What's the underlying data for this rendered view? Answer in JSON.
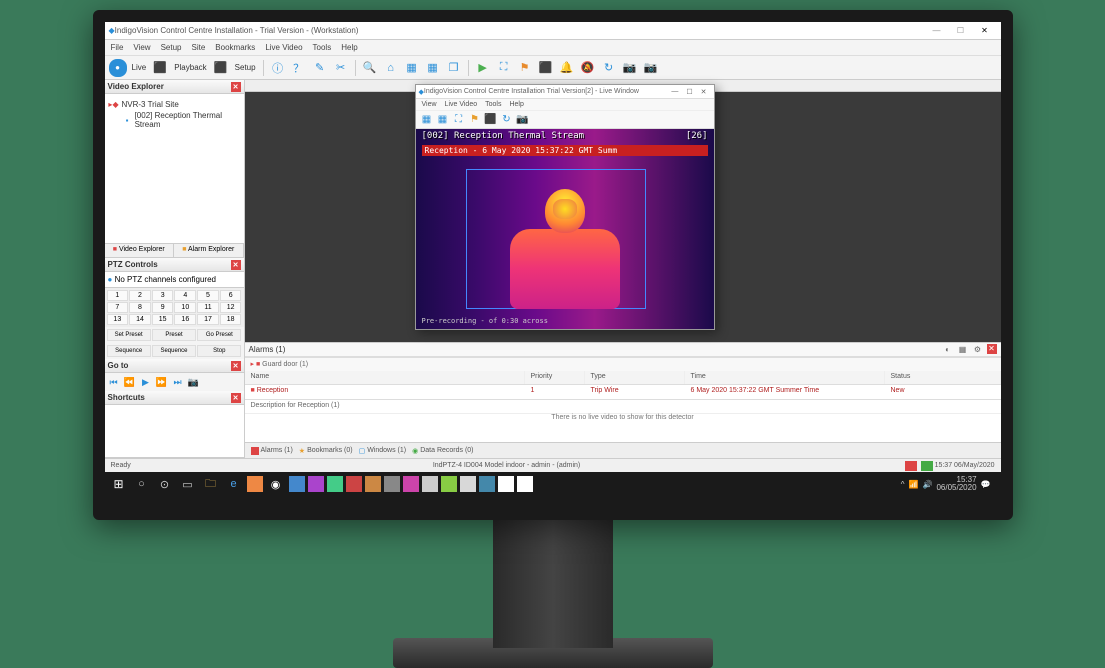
{
  "window": {
    "title": "IndigoVision Control Centre Installation - Trial Version - (Workstation)",
    "win_min": "—",
    "win_max": "☐",
    "win_close": "✕"
  },
  "menubar": [
    "File",
    "View",
    "Setup",
    "Site",
    "Bookmarks",
    "Live Video",
    "Tools",
    "Help"
  ],
  "toolbar": {
    "live_label": "Live",
    "playback_label": "Playback",
    "setup_label": "Setup"
  },
  "sidebar": {
    "explorer_title": "Video Explorer",
    "tree": {
      "site": "NVR-3 Trial Site",
      "camera": "[002] Reception Thermal Stream"
    },
    "tabs": {
      "left": "Video Explorer",
      "right": "Alarm Explorer"
    },
    "ptz_title": "PTZ Controls",
    "ptz_device": "No PTZ channels configured",
    "numbers": [
      "1",
      "2",
      "3",
      "4",
      "5",
      "6",
      "7",
      "8",
      "9",
      "10",
      "11",
      "12",
      "13",
      "14",
      "15",
      "16",
      "17",
      "18"
    ],
    "ptz_buttons": [
      "Set Preset",
      "Preset",
      "Go Preset",
      "Sequence",
      "Sequence",
      "Stop"
    ],
    "pb_title": "Go to",
    "shortcuts_title": "Shortcuts"
  },
  "float": {
    "title": "IndigoVision Control Centre Installation Trial Version[2] - Live Window",
    "menu": [
      "View",
      "Live Video",
      "Tools",
      "Help"
    ],
    "min": "—",
    "max": "☐",
    "close": "✕"
  },
  "thermal": {
    "header_left": "[002] Reception Thermal Stream",
    "header_right": "[26]",
    "subtitle": "Reception - 6 May 2020 15:37:22 GMT Summ",
    "footer": "Pre-recording - of 0:30 across"
  },
  "alarm_panel": {
    "title": "Alarms (1)",
    "guard_label": "Guard door (1)",
    "headers": {
      "name": "Name",
      "priority": "Priority",
      "type": "Type",
      "time": "Time",
      "status": "Status"
    },
    "row": {
      "name": "Reception",
      "priority": "1",
      "type": "Trip Wire",
      "time": "6 May 2020 15:37:22 GMT Summer Time",
      "status": "New"
    },
    "subrow": "Description for Reception (1)",
    "center_msg": "There is no live video to show for this detector"
  },
  "bottom_tabs": {
    "alarms": "Alarms (1)",
    "bookmarks": "Bookmarks (0)",
    "windows": "Windows (1)",
    "recorder": "Data Records (0)"
  },
  "statusbar": {
    "left": "Ready",
    "center": "IndPTZ-4 ID004 Model indoor - admin - (admin)",
    "right_time": "15:37   06/May/2020"
  },
  "taskbar": {
    "time": "15:37",
    "date": "06/05/2020"
  }
}
